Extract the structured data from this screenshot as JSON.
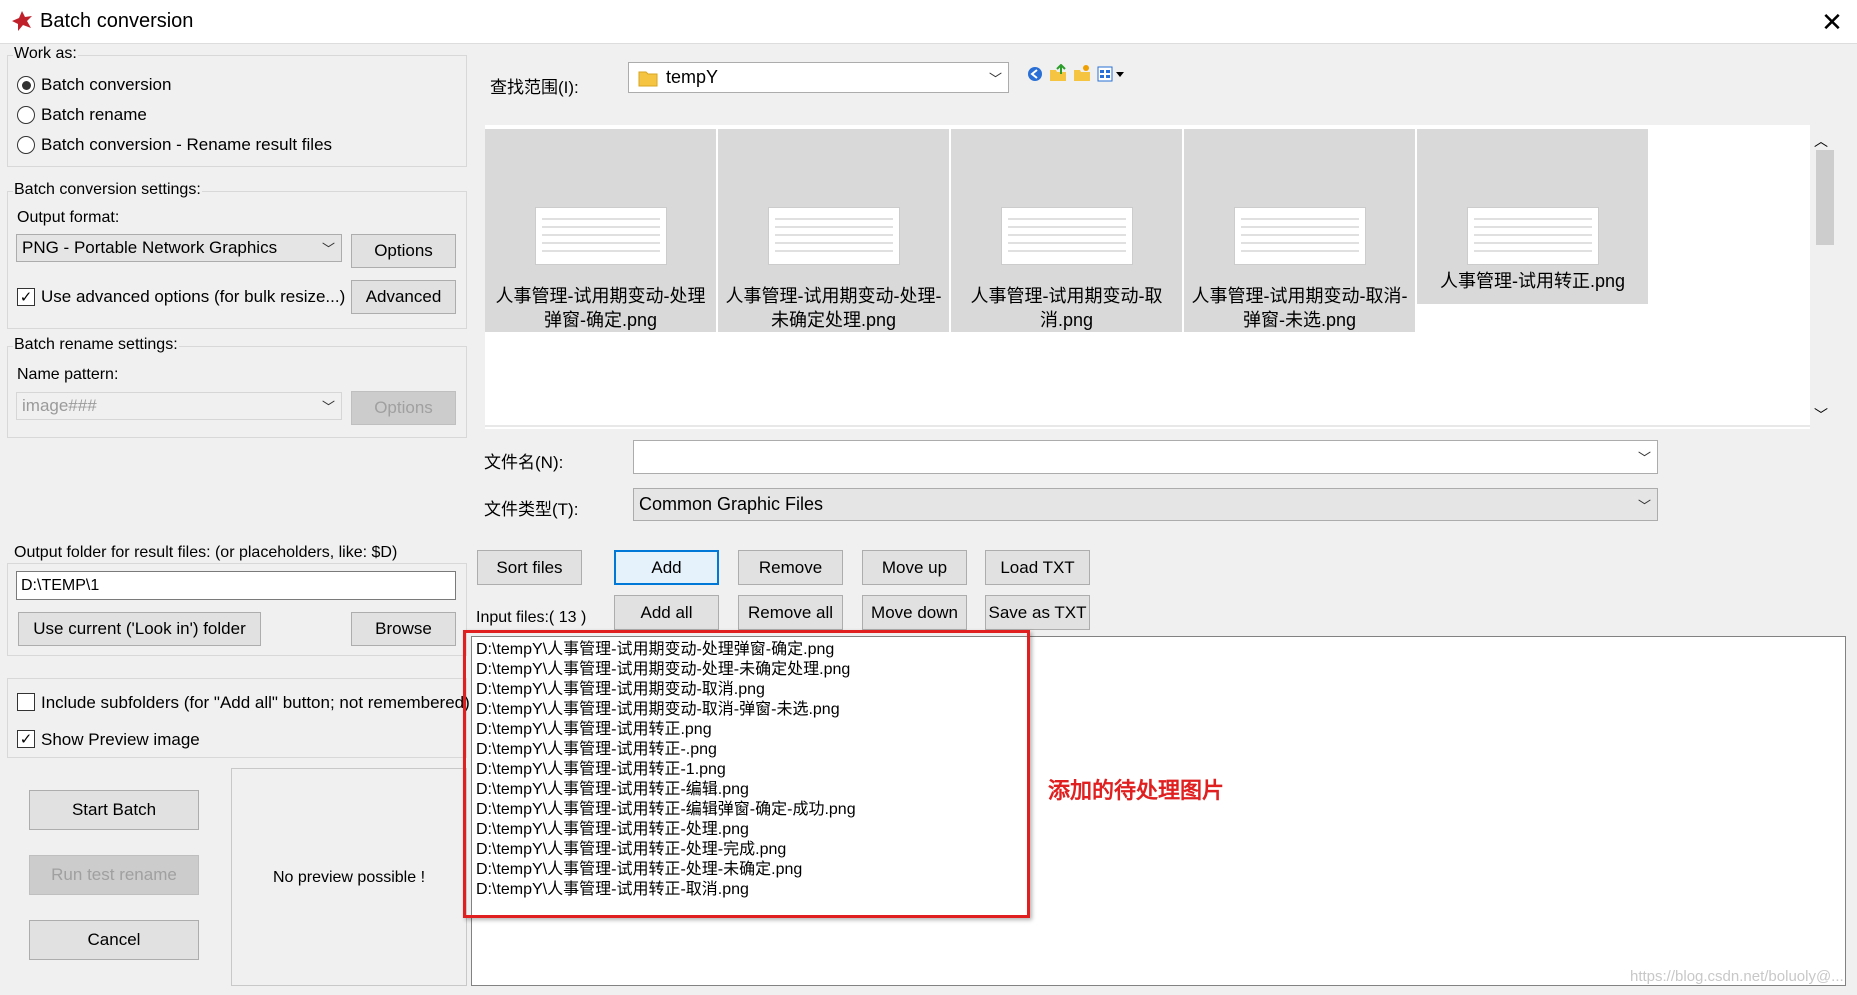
{
  "window": {
    "title": "Batch conversion",
    "close_label": "✕"
  },
  "work_as": {
    "label": "Work as:",
    "options": [
      "Batch conversion",
      "Batch rename",
      "Batch conversion - Rename result files"
    ],
    "selected_index": 0
  },
  "conversion": {
    "label": "Batch conversion settings:",
    "output_format_label": "Output format:",
    "output_format": "PNG - Portable Network Graphics",
    "options_button": "Options",
    "advanced_checkbox": "Use advanced options (for bulk resize...)",
    "advanced_checked": true,
    "advanced_button": "Advanced"
  },
  "rename": {
    "label": "Batch rename settings:",
    "name_pattern_label": "Name pattern:",
    "name_pattern": "image###",
    "options_button": "Options"
  },
  "output": {
    "label": "Output folder for result files: (or placeholders, like: $D)",
    "folder": "D:\\TEMP\\1",
    "use_current_button": "Use current ('Look in') folder",
    "browse_button": "Browse"
  },
  "include_subfolders": {
    "label": "Include subfolders (for \"Add all\" button; not remembered)",
    "checked": false
  },
  "show_preview": {
    "label": "Show Preview image",
    "checked": true
  },
  "actions": {
    "start": "Start Batch",
    "run_test": "Run test rename",
    "cancel": "Cancel"
  },
  "preview_text": "No preview possible !",
  "browser": {
    "look_in_label": "查找范围(I):",
    "look_in_value": "tempY",
    "thumbnails": [
      "人事管理-试用期变动-处理弹窗-确定.png",
      "人事管理-试用期变动-处理-未确定处理.png",
      "人事管理-试用期变动-取消.png",
      "人事管理-试用期变动-取消-弹窗-未选.png",
      "人事管理-试用转正.png"
    ],
    "filename_label": "文件名(N):",
    "filename_value": "",
    "filetype_label": "文件类型(T):",
    "filetype_value": "Common Graphic Files"
  },
  "buttons": {
    "sort": "Sort files",
    "add": "Add",
    "remove": "Remove",
    "move_up": "Move up",
    "load_txt": "Load TXT",
    "add_all": "Add all",
    "remove_all": "Remove all",
    "move_down": "Move down",
    "save_txt": "Save as TXT"
  },
  "input_files": {
    "label": "Input files:( 13 )",
    "files": [
      "D:\\tempY\\人事管理-试用期变动-处理弹窗-确定.png",
      "D:\\tempY\\人事管理-试用期变动-处理-未确定处理.png",
      "D:\\tempY\\人事管理-试用期变动-取消.png",
      "D:\\tempY\\人事管理-试用期变动-取消-弹窗-未选.png",
      "D:\\tempY\\人事管理-试用转正.png",
      "D:\\tempY\\人事管理-试用转正-.png",
      "D:\\tempY\\人事管理-试用转正-1.png",
      "D:\\tempY\\人事管理-试用转正-编辑.png",
      "D:\\tempY\\人事管理-试用转正-编辑弹窗-确定-成功.png",
      "D:\\tempY\\人事管理-试用转正-处理.png",
      "D:\\tempY\\人事管理-试用转正-处理-完成.png",
      "D:\\tempY\\人事管理-试用转正-处理-未确定.png",
      "D:\\tempY\\人事管理-试用转正-取消.png"
    ]
  },
  "annotation": "添加的待处理图片",
  "watermark": "https://blog.csdn.net/boluoly@..."
}
